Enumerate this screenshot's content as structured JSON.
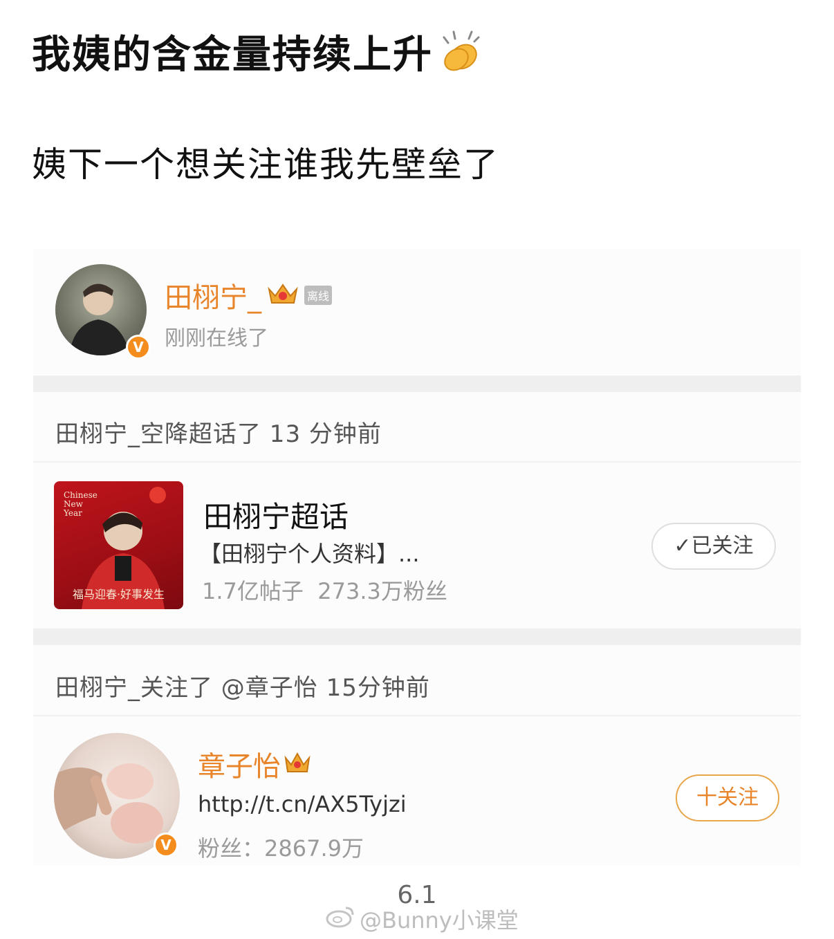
{
  "post": {
    "title": "我姨的含金量持续上升",
    "subtitle": "姨下一个想关注谁我先壁垒了"
  },
  "profile_card": {
    "name": "田栩宁_",
    "status_tag": "离线",
    "online_text": "刚刚在线了",
    "verified_badge": "V"
  },
  "activity_1": {
    "text": "田栩宁_空降超话了 13 分钟前"
  },
  "supertopic": {
    "cover_text_top": "Chinese New Year",
    "cover_text_bottom": "福马迎春·好事发生",
    "title": "田栩宁超话",
    "desc": "【田栩宁个人资料】...",
    "stats": "1.7亿帖子  273.3万粉丝",
    "button_label": "✓已关注"
  },
  "activity_2": {
    "text": "田栩宁_关注了 @章子怡 15分钟前"
  },
  "user_card": {
    "name": "章子怡",
    "url": "http://t.cn/AX5Tyjzi",
    "fans": "粉丝：2867.9万",
    "verified_badge": "V",
    "button_label": "十关注"
  },
  "footer": {
    "page_number": "6.1",
    "watermark": "@Bunny小课堂"
  },
  "colors": {
    "accent_orange": "#e8842a",
    "verified_orange": "#f58c1e",
    "separator_gray": "#efefef"
  }
}
